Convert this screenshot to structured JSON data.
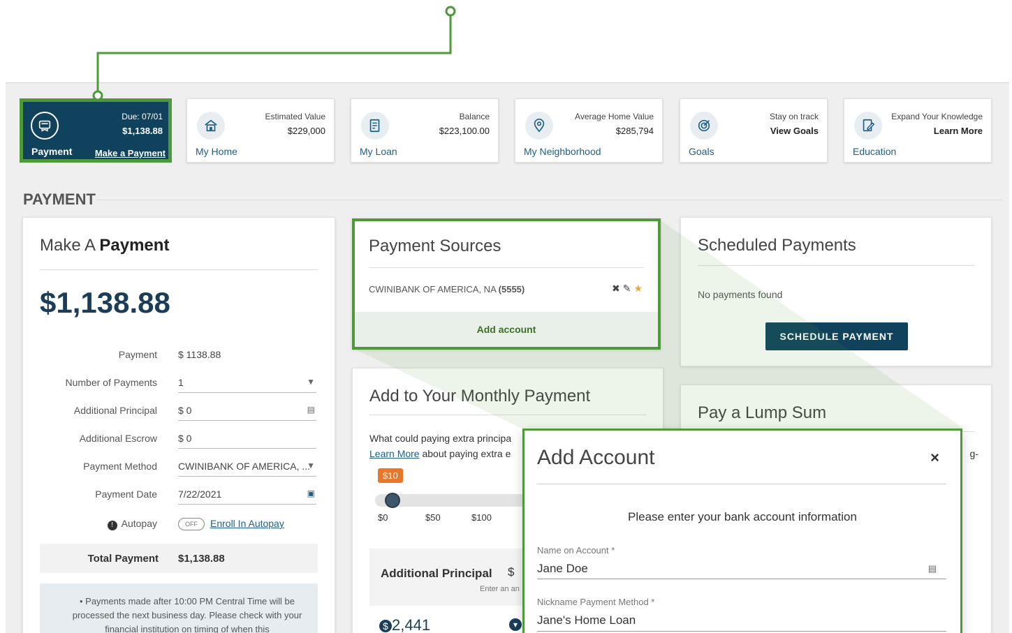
{
  "tiles": [
    {
      "label": "Payment",
      "small": "Due: 07/01",
      "value": "$1,138.88",
      "link": "Make a Payment",
      "icon": "payment-icon"
    },
    {
      "label": "My Home",
      "small": "Estimated Value",
      "value": "$229,000",
      "icon": "home-icon"
    },
    {
      "label": "My Loan",
      "small": "Balance",
      "value": "$223,100.00",
      "icon": "loan-document-icon"
    },
    {
      "label": "My Neighborhood",
      "small": "Average Home Value",
      "value": "$285,794",
      "icon": "location-pin-icon"
    },
    {
      "label": "Goals",
      "small": "Stay on track",
      "value": "View Goals",
      "icon": "target-icon"
    },
    {
      "label": "Education",
      "small": "Expand Your Knowledge",
      "value": "Learn More",
      "icon": "education-icon"
    }
  ],
  "section": {
    "title": "PAYMENT"
  },
  "make_payment": {
    "title_light": "Make A ",
    "title_bold": "Payment",
    "amount": "$1,138.88",
    "fields": [
      {
        "label": "Payment",
        "value": "$  1138.88"
      },
      {
        "label": "Number of Payments",
        "value": "1"
      },
      {
        "label": "Additional Principal",
        "value": "$  0"
      },
      {
        "label": "Additional Escrow",
        "value": "$  0"
      },
      {
        "label": "Payment Method",
        "value": "CWINIBANK OF AMERICA, ..."
      },
      {
        "label": "Payment Date",
        "value": "7/22/2021"
      }
    ],
    "autopay_label": "Autopay",
    "autopay_toggle": "OFF",
    "enroll_link": "Enroll In Autopay",
    "total_label": "Total Payment",
    "total_value": "$1,138.88",
    "note": "Payments made after 10:00 PM Central Time will be processed the next business day.  Please check with your financial institution on timing of when this"
  },
  "payment_sources": {
    "title": "Payment Sources",
    "account": "CWINIBANK OF AMERICA, NA",
    "account_mask": "(5555)",
    "add_account": "Add account"
  },
  "scheduled": {
    "title": "Scheduled Payments",
    "empty": "No payments found",
    "button": "SCHEDULE PAYMENT"
  },
  "monthly": {
    "title": "Add to Your Monthly Payment",
    "text1": "What could paying extra principa",
    "learn_more": "Learn More",
    "text2": " about paying extra e",
    "bubble": "$10",
    "ticks": [
      "$0",
      "$50",
      "$100"
    ],
    "ap_label": "Additional Principal",
    "ap_currency": "$",
    "ap_hint": "Enter an an",
    "savings": "2,441"
  },
  "lump": {
    "title": "Pay a Lump Sum",
    "edge": "g-"
  },
  "modal": {
    "title": "Add Account",
    "close": "×",
    "intro": "Please enter your bank account information",
    "name_label": "Name on Account *",
    "name_value": "Jane Doe",
    "nick_label": "Nickname Payment Method *",
    "nick_value": "Jane's Home Loan"
  }
}
